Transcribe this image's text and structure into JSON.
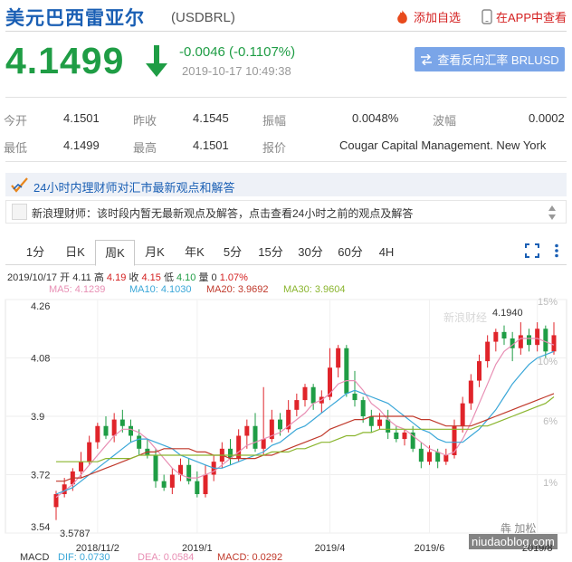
{
  "header": {
    "title": "美元巴西雷亚尔",
    "symbol": "(USDBRL)",
    "add_fav": "添加自选",
    "app_view": "在APP中查看"
  },
  "quote": {
    "price": "4.1499",
    "change": "-0.0046 (-0.1107%)",
    "timestamp": "2019-10-17 10:49:38",
    "reverse_label": "查看反向汇率 BRLUSD",
    "down_color": "#1f9d45",
    "up_color": "#d42020"
  },
  "stats": {
    "open_label": "今开",
    "open": "4.1501",
    "prev_close_label": "昨收",
    "prev_close": "4.1545",
    "amplitude_label": "振幅",
    "amplitude": "0.0048%",
    "wave_label": "波幅",
    "wave": "0.0002",
    "low_label": "最低",
    "low": "4.1499",
    "high_label": "最高",
    "high": "4.1501",
    "quote_label": "报价",
    "quote_source": "Cougar Capital Management. New York"
  },
  "analyst": {
    "banner": "24小时内理财师对汇市最新观点和解答",
    "message": "新浪理财师：该时段内暂无最新观点及解答，点击查看24小时之前的观点及解答"
  },
  "tabs": [
    {
      "label": "1分",
      "active": false
    },
    {
      "label": "日K",
      "active": false
    },
    {
      "label": "周K",
      "active": true
    },
    {
      "label": "月K",
      "active": false
    },
    {
      "label": "年K",
      "active": false
    },
    {
      "label": "5分",
      "active": false
    },
    {
      "label": "15分",
      "active": false
    },
    {
      "label": "30分",
      "active": false
    },
    {
      "label": "60分",
      "active": false
    },
    {
      "label": "4H",
      "active": false
    }
  ],
  "ohlc": {
    "date": "2019/10/17",
    "open_label": "开",
    "open": "4.11",
    "high_label": "高",
    "high": "4.19",
    "close_label": "收",
    "close": "4.15",
    "low_label": "低",
    "low": "4.10",
    "volume_label": "量",
    "volume": "0",
    "pct": "1.07%"
  },
  "ma_labels": [
    {
      "text": "MA5: 4.1239",
      "color": "#e88fb4"
    },
    {
      "text": "MA10: 4.1030",
      "color": "#3aa7d8"
    },
    {
      "text": "MA20: 3.9692",
      "color": "#c0392b"
    },
    {
      "text": "MA30: 3.9604",
      "color": "#8ab52e"
    }
  ],
  "chart_data": {
    "type": "candlestick",
    "x_ticks": [
      "2018/11/2",
      "2019/1",
      "2019/4",
      "2019/6",
      "2019/8"
    ],
    "y_ticks": [
      "4.26",
      "4.08",
      "3.9",
      "3.72",
      "3.54"
    ],
    "ylim": [
      3.54,
      4.26
    ],
    "pct_ticks": [
      "15%",
      "10%",
      "6%",
      "1%"
    ],
    "max_label": "4.1940",
    "min_label": "3.5787",
    "logo": "新浪财经",
    "candles": [
      [
        3.62,
        3.66,
        3.58,
        3.67
      ],
      [
        3.66,
        3.69,
        3.65,
        3.71
      ],
      [
        3.69,
        3.73,
        3.67,
        3.74
      ],
      [
        3.73,
        3.76,
        3.71,
        3.79
      ],
      [
        3.76,
        3.82,
        3.75,
        3.84
      ],
      [
        3.82,
        3.87,
        3.8,
        3.88
      ],
      [
        3.87,
        3.84,
        3.83,
        3.9
      ],
      [
        3.84,
        3.89,
        3.82,
        3.91
      ],
      [
        3.89,
        3.87,
        3.85,
        3.92
      ],
      [
        3.87,
        3.84,
        3.82,
        3.89
      ],
      [
        3.84,
        3.8,
        3.78,
        3.86
      ],
      [
        3.8,
        3.78,
        3.77,
        3.83
      ],
      [
        3.78,
        3.7,
        3.68,
        3.8
      ],
      [
        3.7,
        3.68,
        3.67,
        3.72
      ],
      [
        3.68,
        3.72,
        3.66,
        3.74
      ],
      [
        3.72,
        3.75,
        3.7,
        3.77
      ],
      [
        3.75,
        3.7,
        3.69,
        3.77
      ],
      [
        3.7,
        3.66,
        3.65,
        3.73
      ],
      [
        3.66,
        3.72,
        3.65,
        3.75
      ],
      [
        3.72,
        3.76,
        3.7,
        3.78
      ],
      [
        3.76,
        3.8,
        3.74,
        3.82
      ],
      [
        3.8,
        3.77,
        3.75,
        3.83
      ],
      [
        3.77,
        3.84,
        3.76,
        3.86
      ],
      [
        3.84,
        3.87,
        3.8,
        3.89
      ],
      [
        3.87,
        3.8,
        3.79,
        3.91
      ],
      [
        3.8,
        3.83,
        3.78,
        3.99
      ],
      [
        3.83,
        3.89,
        3.82,
        3.92
      ],
      [
        3.89,
        3.86,
        3.84,
        3.91
      ],
      [
        3.86,
        3.92,
        3.85,
        3.95
      ],
      [
        3.92,
        3.95,
        3.9,
        3.97
      ],
      [
        3.95,
        3.99,
        3.93,
        4.0
      ],
      [
        3.99,
        3.94,
        3.92,
        4.0
      ],
      [
        3.94,
        3.96,
        3.91,
        3.98
      ],
      [
        3.96,
        4.05,
        3.95,
        4.11
      ],
      [
        4.05,
        4.11,
        4.02,
        4.12
      ],
      [
        4.11,
        3.97,
        3.96,
        4.12
      ],
      [
        3.97,
        3.95,
        3.93,
        4.04
      ],
      [
        3.95,
        3.9,
        3.88,
        3.96
      ],
      [
        3.9,
        3.87,
        3.85,
        3.92
      ],
      [
        3.87,
        3.89,
        3.86,
        3.91
      ],
      [
        3.89,
        3.85,
        3.83,
        3.92
      ],
      [
        3.85,
        3.83,
        3.82,
        3.87
      ],
      [
        3.83,
        3.85,
        3.81,
        3.86
      ],
      [
        3.85,
        3.8,
        3.79,
        3.87
      ],
      [
        3.8,
        3.76,
        3.74,
        3.82
      ],
      [
        3.76,
        3.79,
        3.75,
        3.81
      ],
      [
        3.79,
        3.76,
        3.74,
        3.8
      ],
      [
        3.76,
        3.78,
        3.75,
        3.8
      ],
      [
        3.78,
        3.87,
        3.77,
        3.89
      ],
      [
        3.87,
        3.94,
        3.85,
        3.96
      ],
      [
        3.94,
        4.01,
        3.92,
        4.03
      ],
      [
        4.01,
        4.07,
        3.99,
        4.09
      ],
      [
        4.07,
        4.13,
        4.05,
        4.15
      ],
      [
        4.13,
        4.16,
        4.1,
        4.17
      ],
      [
        4.16,
        4.14,
        4.12,
        4.18
      ],
      [
        4.14,
        4.11,
        4.07,
        4.16
      ],
      [
        4.11,
        4.15,
        4.09,
        4.19
      ],
      [
        4.15,
        4.12,
        4.1,
        4.17
      ],
      [
        4.12,
        4.17,
        4.1,
        4.19
      ],
      [
        4.17,
        4.1,
        4.08,
        4.18
      ],
      [
        4.1,
        4.15,
        4.09,
        4.19
      ]
    ],
    "ma_series": [
      {
        "name": "MA5",
        "color": "#e88fb4",
        "values": [
          3.65,
          3.67,
          3.69,
          3.72,
          3.75,
          3.78,
          3.81,
          3.84,
          3.86,
          3.86,
          3.85,
          3.83,
          3.8,
          3.77,
          3.74,
          3.72,
          3.71,
          3.71,
          3.72,
          3.73,
          3.75,
          3.77,
          3.79,
          3.81,
          3.82,
          3.83,
          3.84,
          3.85,
          3.87,
          3.89,
          3.91,
          3.94,
          3.95,
          3.97,
          4.0,
          4.01,
          4.01,
          3.98,
          3.94,
          3.92,
          3.89,
          3.87,
          3.86,
          3.84,
          3.82,
          3.8,
          3.79,
          3.78,
          3.79,
          3.83,
          3.88,
          3.94,
          4.0,
          4.06,
          4.1,
          4.12,
          4.14,
          4.14,
          4.14,
          4.13,
          4.12
        ]
      },
      {
        "name": "MA10",
        "color": "#3aa7d8",
        "values": [
          3.66,
          3.67,
          3.68,
          3.7,
          3.72,
          3.74,
          3.76,
          3.78,
          3.8,
          3.82,
          3.83,
          3.83,
          3.82,
          3.81,
          3.8,
          3.78,
          3.77,
          3.76,
          3.75,
          3.74,
          3.74,
          3.75,
          3.76,
          3.77,
          3.78,
          3.79,
          3.81,
          3.82,
          3.84,
          3.86,
          3.87,
          3.89,
          3.91,
          3.93,
          3.95,
          3.97,
          3.98,
          3.97,
          3.96,
          3.95,
          3.94,
          3.92,
          3.9,
          3.88,
          3.86,
          3.85,
          3.83,
          3.82,
          3.82,
          3.82,
          3.84,
          3.86,
          3.89,
          3.92,
          3.96,
          4.0,
          4.03,
          4.06,
          4.08,
          4.09,
          4.1
        ]
      },
      {
        "name": "MA20",
        "color": "#c0392b",
        "values": [
          3.7,
          3.7,
          3.71,
          3.71,
          3.72,
          3.73,
          3.74,
          3.75,
          3.76,
          3.77,
          3.78,
          3.79,
          3.79,
          3.8,
          3.8,
          3.8,
          3.8,
          3.79,
          3.79,
          3.78,
          3.78,
          3.77,
          3.77,
          3.77,
          3.77,
          3.78,
          3.78,
          3.79,
          3.8,
          3.81,
          3.82,
          3.83,
          3.84,
          3.86,
          3.87,
          3.88,
          3.89,
          3.89,
          3.9,
          3.9,
          3.9,
          3.9,
          3.9,
          3.9,
          3.89,
          3.89,
          3.88,
          3.87,
          3.87,
          3.87,
          3.87,
          3.88,
          3.89,
          3.9,
          3.91,
          3.92,
          3.93,
          3.94,
          3.95,
          3.96,
          3.97
        ]
      },
      {
        "name": "MA30",
        "color": "#8ab52e",
        "values": [
          3.76,
          3.76,
          3.76,
          3.76,
          3.76,
          3.76,
          3.77,
          3.77,
          3.77,
          3.77,
          3.78,
          3.78,
          3.78,
          3.78,
          3.78,
          3.78,
          3.78,
          3.78,
          3.78,
          3.78,
          3.78,
          3.78,
          3.78,
          3.78,
          3.78,
          3.78,
          3.79,
          3.79,
          3.79,
          3.8,
          3.8,
          3.81,
          3.82,
          3.82,
          3.83,
          3.84,
          3.84,
          3.85,
          3.85,
          3.86,
          3.86,
          3.86,
          3.86,
          3.86,
          3.86,
          3.86,
          3.86,
          3.86,
          3.86,
          3.86,
          3.86,
          3.87,
          3.87,
          3.88,
          3.89,
          3.9,
          3.91,
          3.92,
          3.93,
          3.94,
          3.96
        ]
      }
    ]
  },
  "macd_labels": [
    {
      "text": "MACD",
      "color": "#333333"
    },
    {
      "text": "DIF: 0.0730",
      "color": "#3aa7d8"
    },
    {
      "text": "DEA: 0.0584",
      "color": "#e88fb4"
    },
    {
      "text": "MACD: 0.0292",
      "color": "#c0392b"
    }
  ],
  "watermark": "niudaoblog.com",
  "watermark2": "犇 加松"
}
